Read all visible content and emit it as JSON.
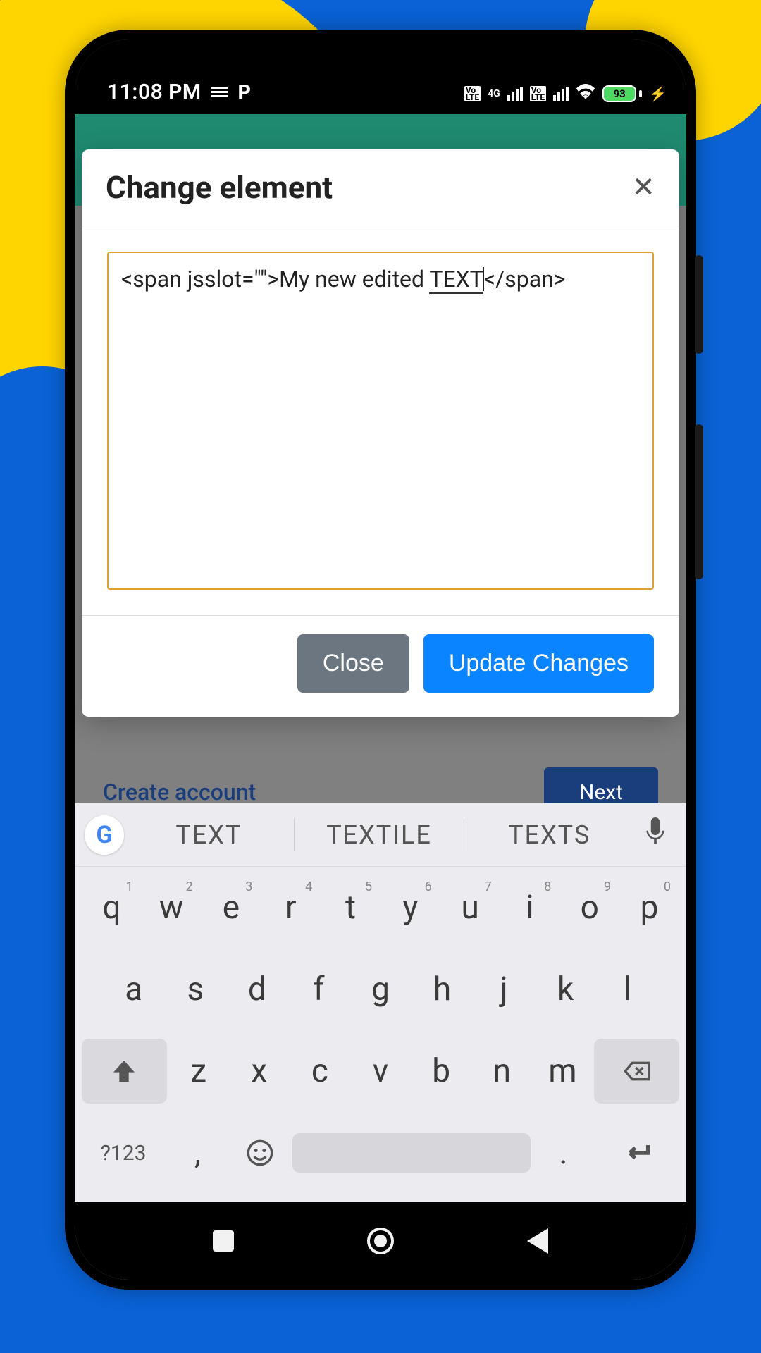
{
  "statusbar": {
    "time": "11:08 PM",
    "battery_percent": "93"
  },
  "dialog": {
    "title": "Change element",
    "textarea_value": "<span jsslot=\"\">My new edited TEXT</span>",
    "text_prefix": "<span jsslot=\"\">My new edited ",
    "text_underlined": "TEXT",
    "text_suffix": "</span>",
    "close_label": "Close",
    "update_label": "Update Changes"
  },
  "background_page": {
    "create_account": "Create account",
    "next": "Next"
  },
  "keyboard": {
    "suggestions": [
      "TEXT",
      "TEXTILE",
      "TEXTS"
    ],
    "row1": [
      {
        "k": "q",
        "n": "1"
      },
      {
        "k": "w",
        "n": "2"
      },
      {
        "k": "e",
        "n": "3"
      },
      {
        "k": "r",
        "n": "4"
      },
      {
        "k": "t",
        "n": "5"
      },
      {
        "k": "y",
        "n": "6"
      },
      {
        "k": "u",
        "n": "7"
      },
      {
        "k": "i",
        "n": "8"
      },
      {
        "k": "o",
        "n": "9"
      },
      {
        "k": "p",
        "n": "0"
      }
    ],
    "row2": [
      "a",
      "s",
      "d",
      "f",
      "g",
      "h",
      "j",
      "k",
      "l"
    ],
    "row3": [
      "z",
      "x",
      "c",
      "v",
      "b",
      "n",
      "m"
    ],
    "sym_label": "?123",
    "comma": ",",
    "period": "."
  }
}
